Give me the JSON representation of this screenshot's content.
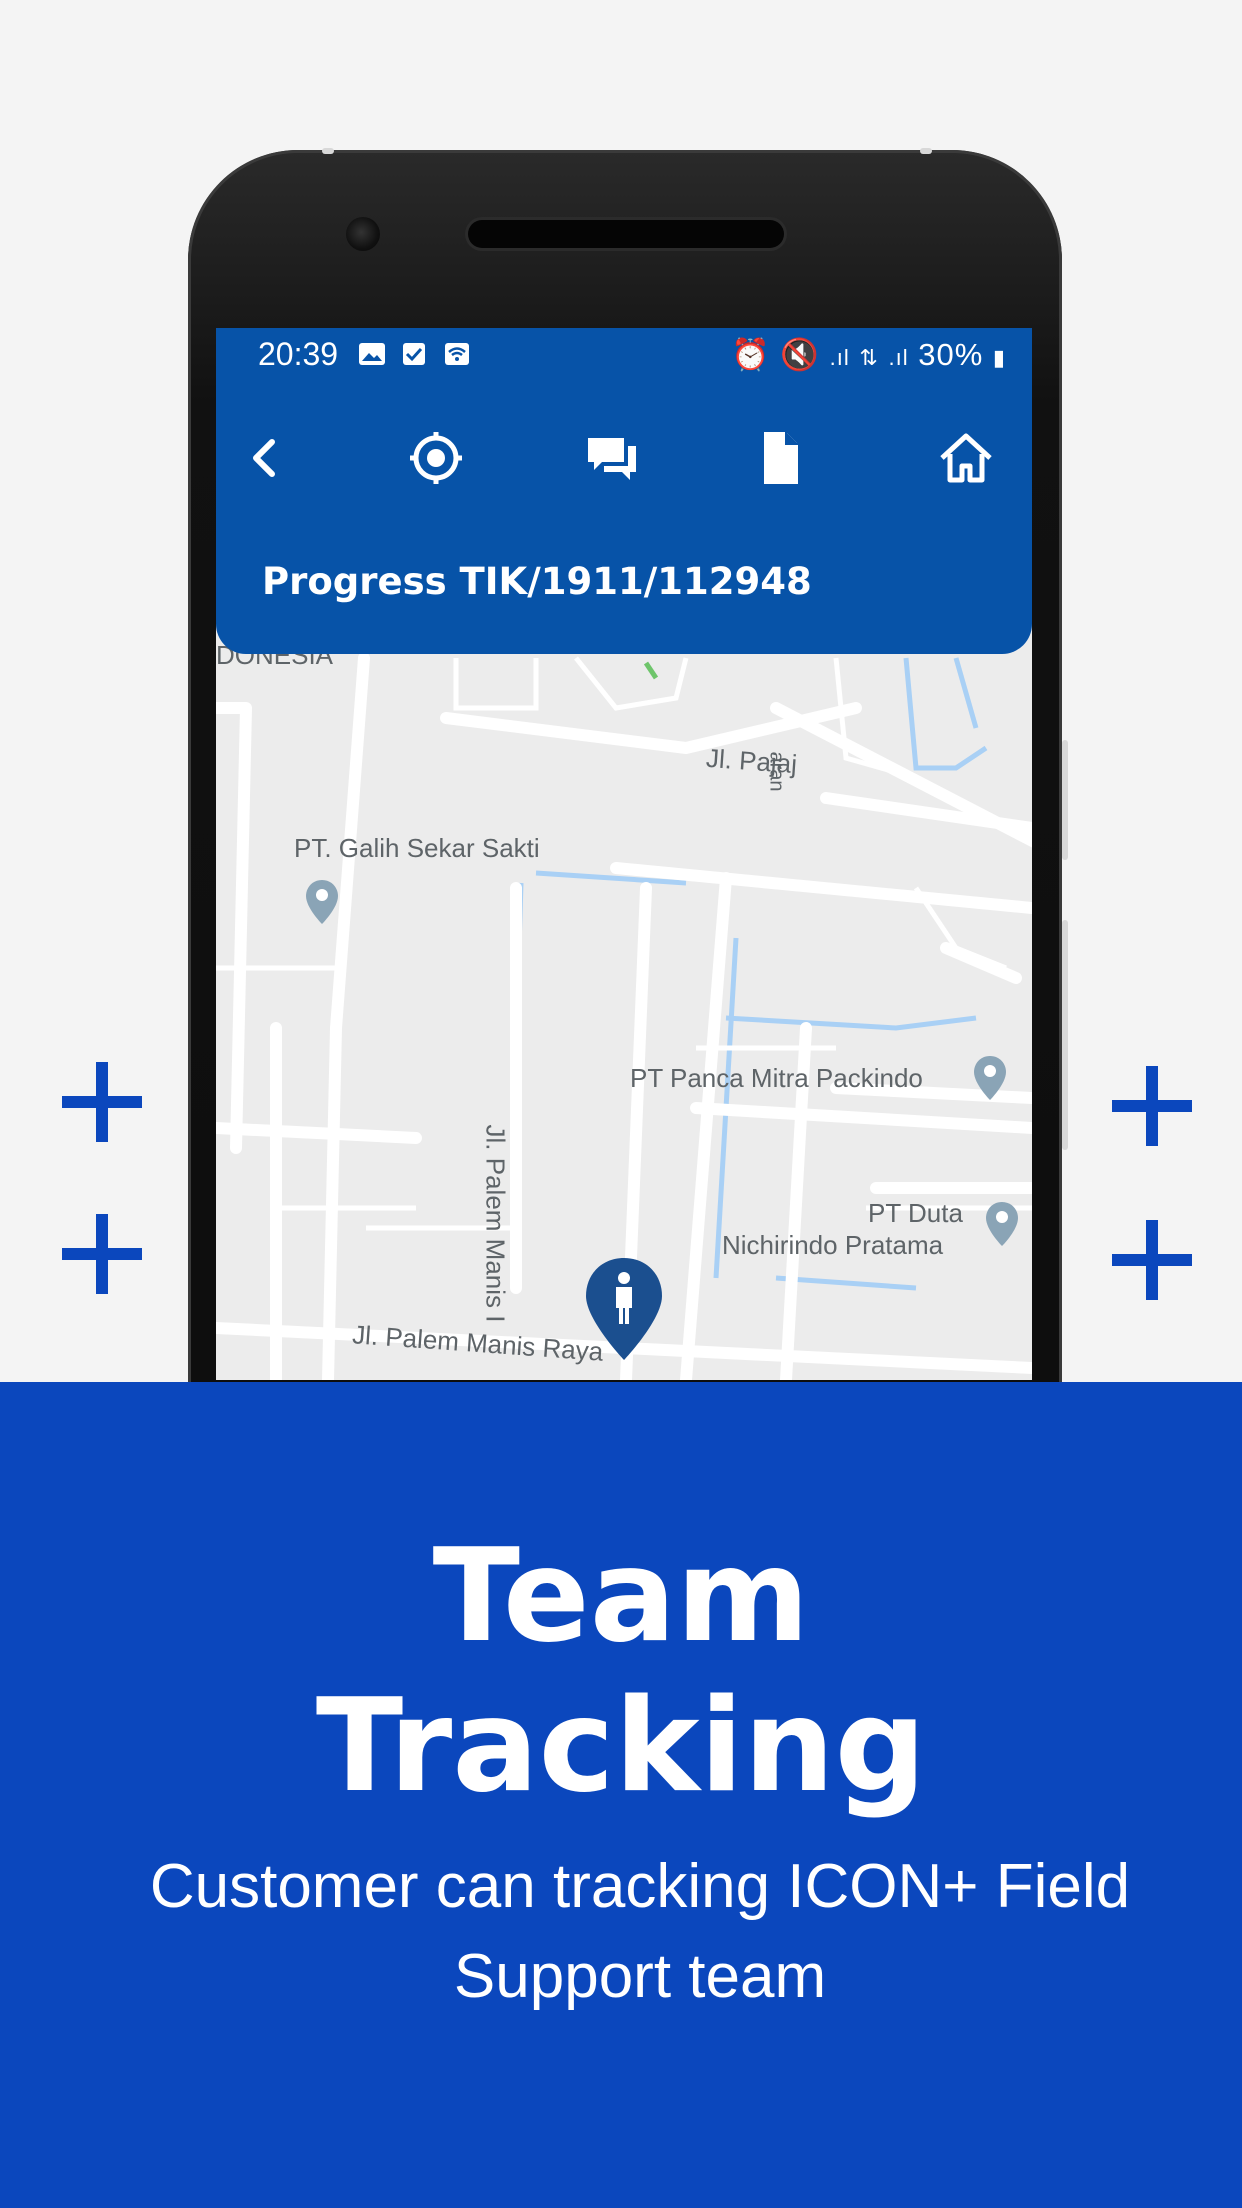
{
  "status_bar": {
    "time": "20:39",
    "battery": "30%"
  },
  "app_bar": {
    "icons": [
      "back-icon",
      "locate-icon",
      "chat-icon",
      "document-icon",
      "home-icon"
    ],
    "title": "Progress TIK/1911/112948"
  },
  "map": {
    "labels": {
      "top_left": "DONESIA",
      "street_1": "Jl. Pajaj",
      "street_1b": "aran",
      "poi_1": "PT. Galih Sekar Sakti",
      "poi_2": "PT Panca Mitra Packindo",
      "poi_3_line1": "PT Duta",
      "poi_3_line2": "Nichirindo Pratama",
      "street_2": "Jl. Palem Manis I",
      "street_3": "Jl. Palem Manis Raya"
    },
    "marker": "person-marker-icon"
  },
  "banner": {
    "headline_line1": "Team",
    "headline_line2": "Tracking",
    "subtitle_line1": "Customer can tracking ICON+ Field",
    "subtitle_line2": "Support team"
  },
  "colors": {
    "app_bar": "#0753a8",
    "banner": "#0b47bd",
    "accent_plus": "#0b47bd",
    "background": "#f4f4f4"
  }
}
